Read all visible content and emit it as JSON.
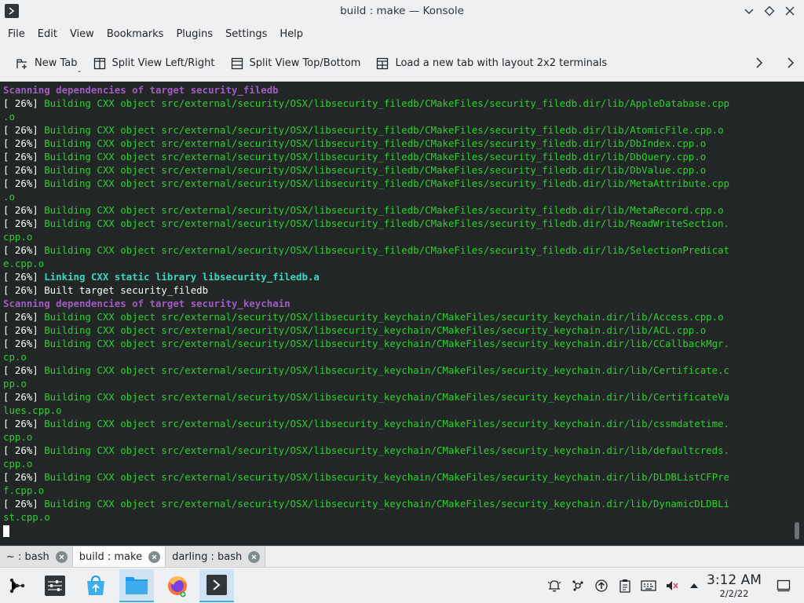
{
  "window": {
    "title": "build : make — Konsole"
  },
  "menu": [
    "File",
    "Edit",
    "View",
    "Bookmarks",
    "Plugins",
    "Settings",
    "Help"
  ],
  "toolbar": {
    "new_tab": "New Tab",
    "split_lr": "Split View Left/Right",
    "split_tb": "Split View Top/Bottom",
    "load_layout": "Load a new tab with layout 2x2 terminals"
  },
  "terminal": {
    "lines": [
      {
        "t": "Scanning dependencies of target security_filedb",
        "c": "purple"
      },
      {
        "p": "[ 26%] ",
        "t": "Building CXX object src/external/security/OSX/libsecurity_filedb/CMakeFiles/security_filedb.dir/lib/AppleDatabase.cpp",
        "c": "green"
      },
      {
        "t": ".o",
        "c": "green"
      },
      {
        "p": "[ 26%] ",
        "t": "Building CXX object src/external/security/OSX/libsecurity_filedb/CMakeFiles/security_filedb.dir/lib/AtomicFile.cpp.o",
        "c": "green"
      },
      {
        "p": "[ 26%] ",
        "t": "Building CXX object src/external/security/OSX/libsecurity_filedb/CMakeFiles/security_filedb.dir/lib/DbIndex.cpp.o",
        "c": "green"
      },
      {
        "p": "[ 26%] ",
        "t": "Building CXX object src/external/security/OSX/libsecurity_filedb/CMakeFiles/security_filedb.dir/lib/DbQuery.cpp.o",
        "c": "green"
      },
      {
        "p": "[ 26%] ",
        "t": "Building CXX object src/external/security/OSX/libsecurity_filedb/CMakeFiles/security_filedb.dir/lib/DbValue.cpp.o",
        "c": "green"
      },
      {
        "p": "[ 26%] ",
        "t": "Building CXX object src/external/security/OSX/libsecurity_filedb/CMakeFiles/security_filedb.dir/lib/MetaAttribute.cpp",
        "c": "green"
      },
      {
        "t": ".o",
        "c": "green"
      },
      {
        "p": "[ 26%] ",
        "t": "Building CXX object src/external/security/OSX/libsecurity_filedb/CMakeFiles/security_filedb.dir/lib/MetaRecord.cpp.o",
        "c": "green"
      },
      {
        "p": "[ 26%] ",
        "t": "Building CXX object src/external/security/OSX/libsecurity_filedb/CMakeFiles/security_filedb.dir/lib/ReadWriteSection.",
        "c": "green"
      },
      {
        "t": "cpp.o",
        "c": "green"
      },
      {
        "p": "[ 26%] ",
        "t": "Building CXX object src/external/security/OSX/libsecurity_filedb/CMakeFiles/security_filedb.dir/lib/SelectionPredicat",
        "c": "green"
      },
      {
        "t": "e.cpp.o",
        "c": "green"
      },
      {
        "p": "[ 26%] ",
        "t": "Linking CXX static library libsecurity_filedb.a",
        "c": "bright"
      },
      {
        "p": "[ 26%] ",
        "t": "Built target security_filedb",
        "c": "white"
      },
      {
        "t": "Scanning dependencies of target security_keychain",
        "c": "purple"
      },
      {
        "p": "[ 26%] ",
        "t": "Building CXX object src/external/security/OSX/libsecurity_keychain/CMakeFiles/security_keychain.dir/lib/Access.cpp.o",
        "c": "green"
      },
      {
        "p": "[ 26%] ",
        "t": "Building CXX object src/external/security/OSX/libsecurity_keychain/CMakeFiles/security_keychain.dir/lib/ACL.cpp.o",
        "c": "green"
      },
      {
        "p": "[ 26%] ",
        "t": "Building CXX object src/external/security/OSX/libsecurity_keychain/CMakeFiles/security_keychain.dir/lib/CCallbackMgr.",
        "c": "green"
      },
      {
        "t": "cp.o",
        "c": "green"
      },
      {
        "p": "[ 26%] ",
        "t": "Building CXX object src/external/security/OSX/libsecurity_keychain/CMakeFiles/security_keychain.dir/lib/Certificate.c",
        "c": "green"
      },
      {
        "t": "pp.o",
        "c": "green"
      },
      {
        "p": "[ 26%] ",
        "t": "Building CXX object src/external/security/OSX/libsecurity_keychain/CMakeFiles/security_keychain.dir/lib/CertificateVa",
        "c": "green"
      },
      {
        "t": "lues.cpp.o",
        "c": "green"
      },
      {
        "p": "[ 26%] ",
        "t": "Building CXX object src/external/security/OSX/libsecurity_keychain/CMakeFiles/security_keychain.dir/lib/cssmdatetime.",
        "c": "green"
      },
      {
        "t": "cpp.o",
        "c": "green"
      },
      {
        "p": "[ 26%] ",
        "t": "Building CXX object src/external/security/OSX/libsecurity_keychain/CMakeFiles/security_keychain.dir/lib/defaultcreds.",
        "c": "green"
      },
      {
        "t": "cpp.o",
        "c": "green"
      },
      {
        "p": "[ 26%] ",
        "t": "Building CXX object src/external/security/OSX/libsecurity_keychain/CMakeFiles/security_keychain.dir/lib/DLDBListCFPre",
        "c": "green"
      },
      {
        "t": "f.cpp.o",
        "c": "green"
      },
      {
        "p": "[ 26%] ",
        "t": "Building CXX object src/external/security/OSX/libsecurity_keychain/CMakeFiles/security_keychain.dir/lib/DynamicDLDBLi",
        "c": "green"
      },
      {
        "t": "st.cpp.o",
        "c": "green"
      }
    ]
  },
  "tabs": [
    {
      "label": "~ : bash",
      "active": false
    },
    {
      "label": "build : make",
      "active": true
    },
    {
      "label": "darling : bash",
      "active": false
    }
  ],
  "taskbar": {
    "apps": [
      "application-launcher-icon",
      "system-settings-icon",
      "discover-store-icon",
      "file-manager-icon",
      "firefox-icon",
      "konsole-icon"
    ],
    "clock_time": "3:12 AM",
    "clock_date": "2/2/22"
  },
  "colors": {
    "terminal_bg": "#232627",
    "green": "#2bd22b",
    "purple": "#a15cbf",
    "accent": "#3daee9"
  }
}
